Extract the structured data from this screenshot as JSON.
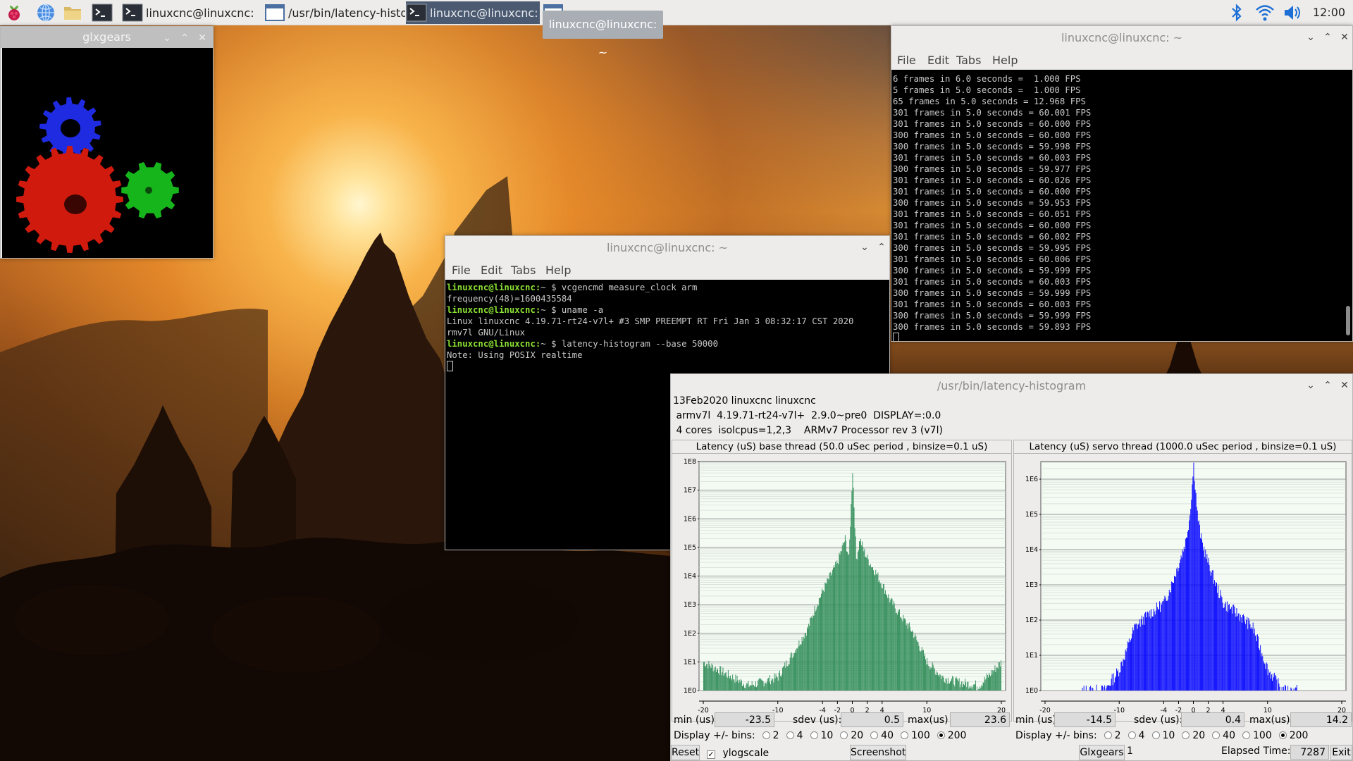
{
  "taskbar": {
    "tasks": [
      {
        "label": "linuxcnc@linuxcnc: ~"
      },
      {
        "label": "/usr/bin/latency-histo..."
      },
      {
        "label": "linuxcnc@linuxcnc: ~"
      }
    ],
    "tooltip": "linuxcnc@linuxcnc: ~",
    "clock": "12:00",
    "icons": [
      "raspberry-menu-icon",
      "browser-globe-icon",
      "file-manager-icon",
      "terminal-icon",
      "bluetooth-icon",
      "wifi-icon",
      "volume-icon"
    ]
  },
  "glxgears": {
    "title": "glxgears",
    "gear_colors": [
      "#d01a0e",
      "#1f2be0",
      "#17b51c"
    ]
  },
  "term_fps": {
    "title": "linuxcnc@linuxcnc: ~",
    "menu": [
      "File",
      "Edit",
      "Tabs",
      "Help"
    ],
    "lines": [
      "6 frames in 6.0 seconds =  1.000 FPS",
      "5 frames in 5.0 seconds =  1.000 FPS",
      "65 frames in 5.0 seconds = 12.968 FPS",
      "301 frames in 5.0 seconds = 60.001 FPS",
      "301 frames in 5.0 seconds = 60.000 FPS",
      "300 frames in 5.0 seconds = 60.000 FPS",
      "300 frames in 5.0 seconds = 59.998 FPS",
      "301 frames in 5.0 seconds = 60.003 FPS",
      "300 frames in 5.0 seconds = 59.977 FPS",
      "301 frames in 5.0 seconds = 60.026 FPS",
      "301 frames in 5.0 seconds = 60.000 FPS",
      "300 frames in 5.0 seconds = 59.953 FPS",
      "301 frames in 5.0 seconds = 60.051 FPS",
      "301 frames in 5.0 seconds = 60.000 FPS",
      "301 frames in 5.0 seconds = 60.002 FPS",
      "300 frames in 5.0 seconds = 59.995 FPS",
      "301 frames in 5.0 seconds = 60.006 FPS",
      "300 frames in 5.0 seconds = 59.999 FPS",
      "301 frames in 5.0 seconds = 60.003 FPS",
      "300 frames in 5.0 seconds = 59.999 FPS",
      "301 frames in 5.0 seconds = 60.003 FPS",
      "300 frames in 5.0 seconds = 59.999 FPS",
      "300 frames in 5.0 seconds = 59.893 FPS"
    ]
  },
  "term_cmd": {
    "title": "linuxcnc@linuxcnc: ~",
    "menu": [
      "File",
      "Edit",
      "Tabs",
      "Help"
    ],
    "prompt": "linuxcnc@linuxcnc:",
    "tail": "~ $ ",
    "lines": [
      {
        "cmd": "vcgencmd measure_clock arm"
      },
      {
        "out": "frequency(48)=1600435584"
      },
      {
        "cmd": "uname -a"
      },
      {
        "out": "Linux linuxcnc 4.19.71-rt24-v7l+ #3 SMP PREEMPT RT Fri Jan 3 08:32:17 CST 2020"
      },
      {
        "out": "rmv7l GNU/Linux"
      },
      {
        "cmd": "latency-histogram --base 50000"
      },
      {
        "out": "Note: Using POSIX realtime"
      }
    ]
  },
  "histogram": {
    "title": "/usr/bin/latency-histogram",
    "info": [
      "13Feb2020 linuxcnc linuxcnc",
      " armv7l  4.19.71-rt24-v7l+  2.9.0~pre0  DISPLAY=:0.0",
      " 4 cores  isolcpus=1,2,3    ARMv7 Processor rev 3 (v7l)"
    ],
    "labels": {
      "min": "min (us)",
      "sdev": "sdev (us):",
      "max": "max(us)",
      "display_bins": "Display +/- bins:"
    },
    "bin_options": [
      "2",
      "4",
      "10",
      "20",
      "40",
      "100",
      "200"
    ],
    "selected_bins": "200",
    "buttons": {
      "reset": "Reset",
      "ylogscale": "ylogscale",
      "screenshot": "Screenshot",
      "glxgears": "Glxgears",
      "glxgears_count": "1",
      "elapsed_label": "Elapsed Time:",
      "elapsed": "7287",
      "exit": "Exit"
    },
    "ylogscale_checked": true
  },
  "chart_data": [
    {
      "type": "bar",
      "title": "Latency (uS) base thread (50.0 uSec period , binsize=0.1 uS)",
      "color": "#2e8b57",
      "xlim": [
        -20,
        20
      ],
      "xticks": [
        "-20",
        "-10",
        "-4",
        "-2",
        "0",
        "2",
        "4",
        "10",
        "20"
      ],
      "yticks": [
        "1E0",
        "1E1",
        "1E2",
        "1E3",
        "1E4",
        "1E5",
        "1E6",
        "1E7",
        "1E8"
      ],
      "ylog_range": [
        0,
        8
      ],
      "y_scale": "log",
      "grid": true,
      "x": [
        -20,
        -14,
        -12,
        -10,
        -8,
        -6,
        -5,
        -4,
        -3,
        -2,
        -1.5,
        -1,
        -0.5,
        0,
        0.5,
        1,
        1.5,
        2,
        3,
        4,
        5,
        6,
        8,
        10,
        12,
        14,
        17,
        20
      ],
      "values": [
        10,
        1.5,
        2,
        3,
        20,
        150,
        800,
        3000,
        10000,
        30000,
        80000,
        200000,
        40000,
        50000000,
        40000,
        200000,
        80000,
        40000,
        15000,
        5000,
        1500,
        600,
        120,
        10,
        3,
        2,
        1.5,
        10
      ],
      "stats": {
        "min": "-23.5",
        "sdev": "0.5",
        "max": "23.6"
      }
    },
    {
      "type": "bar",
      "title": "Latency (uS) servo thread (1000.0 uSec period , binsize=0.1 uS)",
      "color": "#0000ff",
      "xlim": [
        -20,
        20
      ],
      "xticks": [
        "-20",
        "-10",
        "-4",
        "-2",
        "0",
        "2",
        "4",
        "10",
        "20"
      ],
      "yticks": [
        "1E0",
        "1E1",
        "1E2",
        "1E3",
        "1E4",
        "1E5",
        "1E6"
      ],
      "ylog_range": [
        0,
        6.5
      ],
      "y_scale": "log",
      "grid": true,
      "x": [
        -15,
        -12,
        -10,
        -8,
        -6,
        -4,
        -3,
        -2,
        -1,
        -0.5,
        0,
        0.5,
        1,
        2,
        3,
        4,
        6,
        8,
        10,
        12,
        14.2
      ],
      "values": [
        1,
        1,
        4,
        60,
        150,
        300,
        1000,
        4000,
        20000,
        100000,
        2500000,
        100000,
        20000,
        4000,
        1000,
        300,
        150,
        60,
        4,
        1,
        1
      ],
      "stats": {
        "min": "-14.5",
        "sdev": "0.4",
        "max": "14.2"
      }
    }
  ]
}
